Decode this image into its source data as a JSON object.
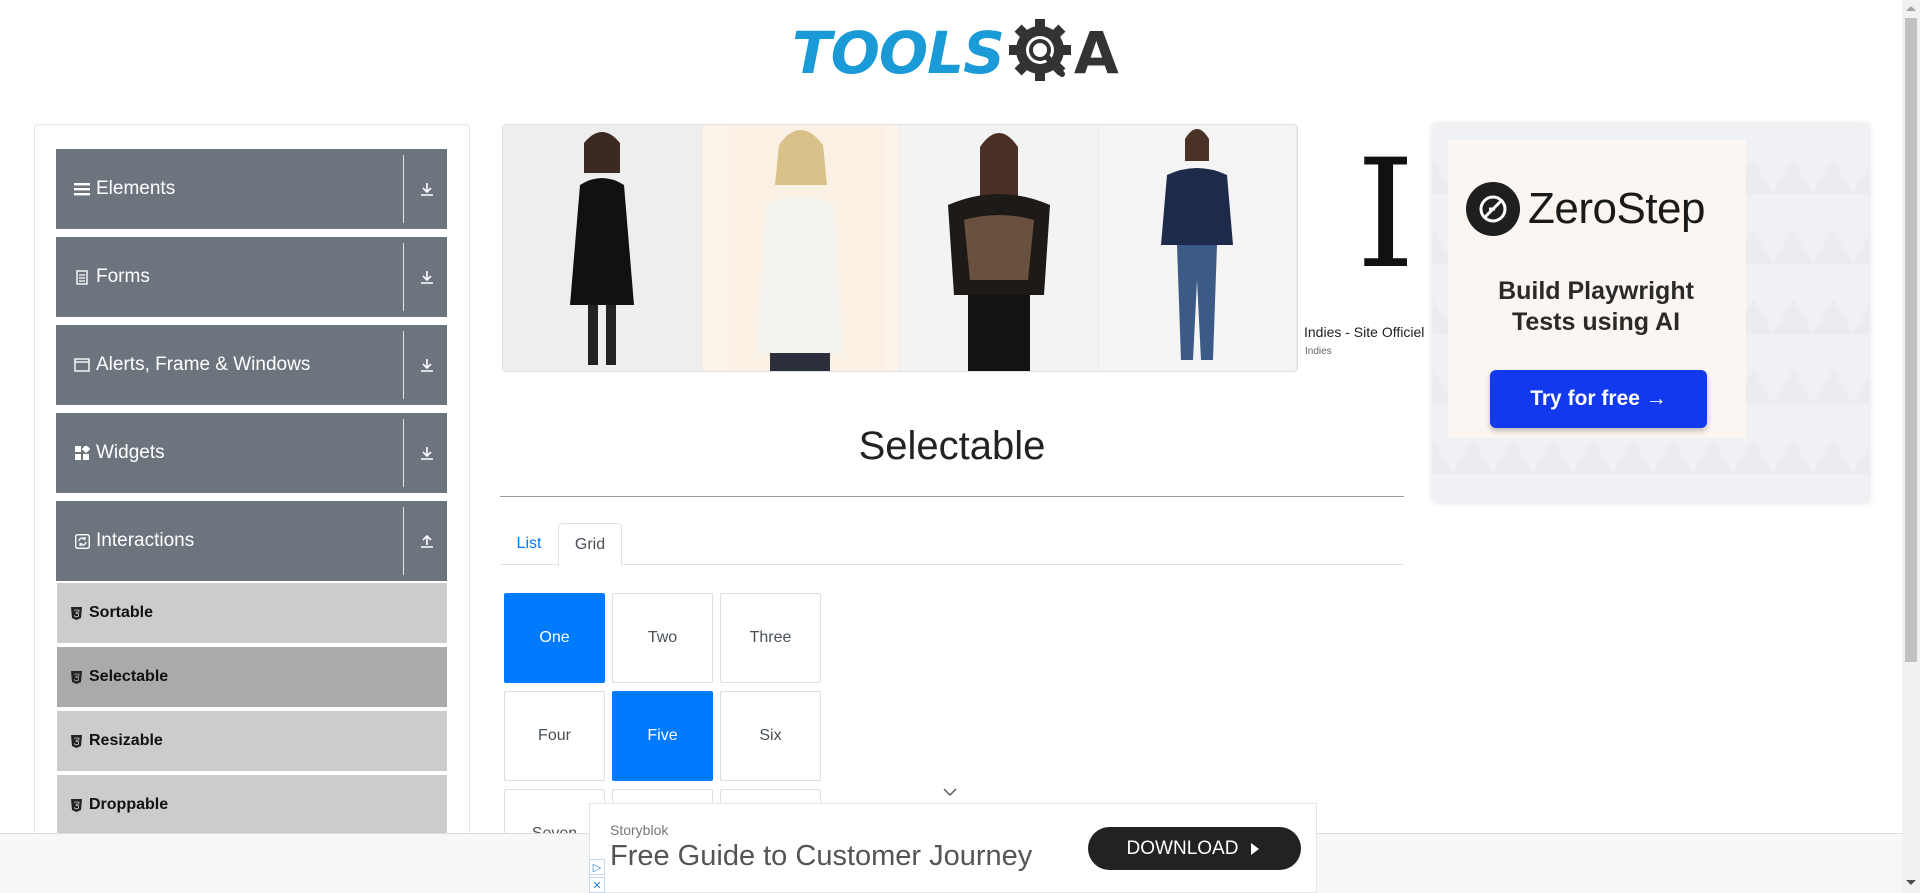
{
  "header": {
    "logo_text_left": "TOOLS",
    "logo_text_right": "A"
  },
  "sidebar": {
    "groups": [
      {
        "label": "Elements",
        "icon": "hamburger-icon",
        "toggle": "download-arrow-icon"
      },
      {
        "label": "Forms",
        "icon": "document-icon",
        "toggle": "download-arrow-icon"
      },
      {
        "label": "Alerts, Frame & Windows",
        "icon": "window-icon",
        "toggle": "download-arrow-icon"
      },
      {
        "label": "Widgets",
        "icon": "widgets-icon",
        "toggle": "download-arrow-icon"
      },
      {
        "label": "Interactions",
        "icon": "refresh-icon",
        "toggle": "upload-arrow-icon"
      }
    ],
    "items": [
      {
        "label": "Sortable",
        "active": false
      },
      {
        "label": "Selectable",
        "active": true
      },
      {
        "label": "Resizable",
        "active": false
      },
      {
        "label": "Droppable",
        "active": false
      }
    ]
  },
  "gallery_ad": {
    "brand_mark": "I",
    "brand_name": "Indies - Site Officiel",
    "brand_sub": "Indies"
  },
  "side_ad": {
    "brand": "ZeroStep",
    "headline_line1": "Build Playwright",
    "headline_line2": "Tests using AI",
    "cta": "Try for free →"
  },
  "main": {
    "title": "Selectable",
    "tabs": [
      {
        "label": "List",
        "active": false
      },
      {
        "label": "Grid",
        "active": true
      }
    ],
    "grid": [
      {
        "label": "One",
        "active": true
      },
      {
        "label": "Two",
        "active": false
      },
      {
        "label": "Three",
        "active": false
      },
      {
        "label": "Four",
        "active": false
      },
      {
        "label": "Five",
        "active": true
      },
      {
        "label": "Six",
        "active": false
      },
      {
        "label": "Seven",
        "active": false
      }
    ]
  },
  "bottom_ad": {
    "brand": "Storyblok",
    "headline": "Free Guide to Customer Journey",
    "cta": "DOWNLOAD"
  },
  "colors": {
    "primary": "#007bff",
    "sidebar_header": "#6c757d",
    "menu_item": "#cccccc",
    "menu_item_active": "#aaaaaa",
    "logo_blue": "#1a9bd7",
    "cta_blue": "#1339ef"
  }
}
